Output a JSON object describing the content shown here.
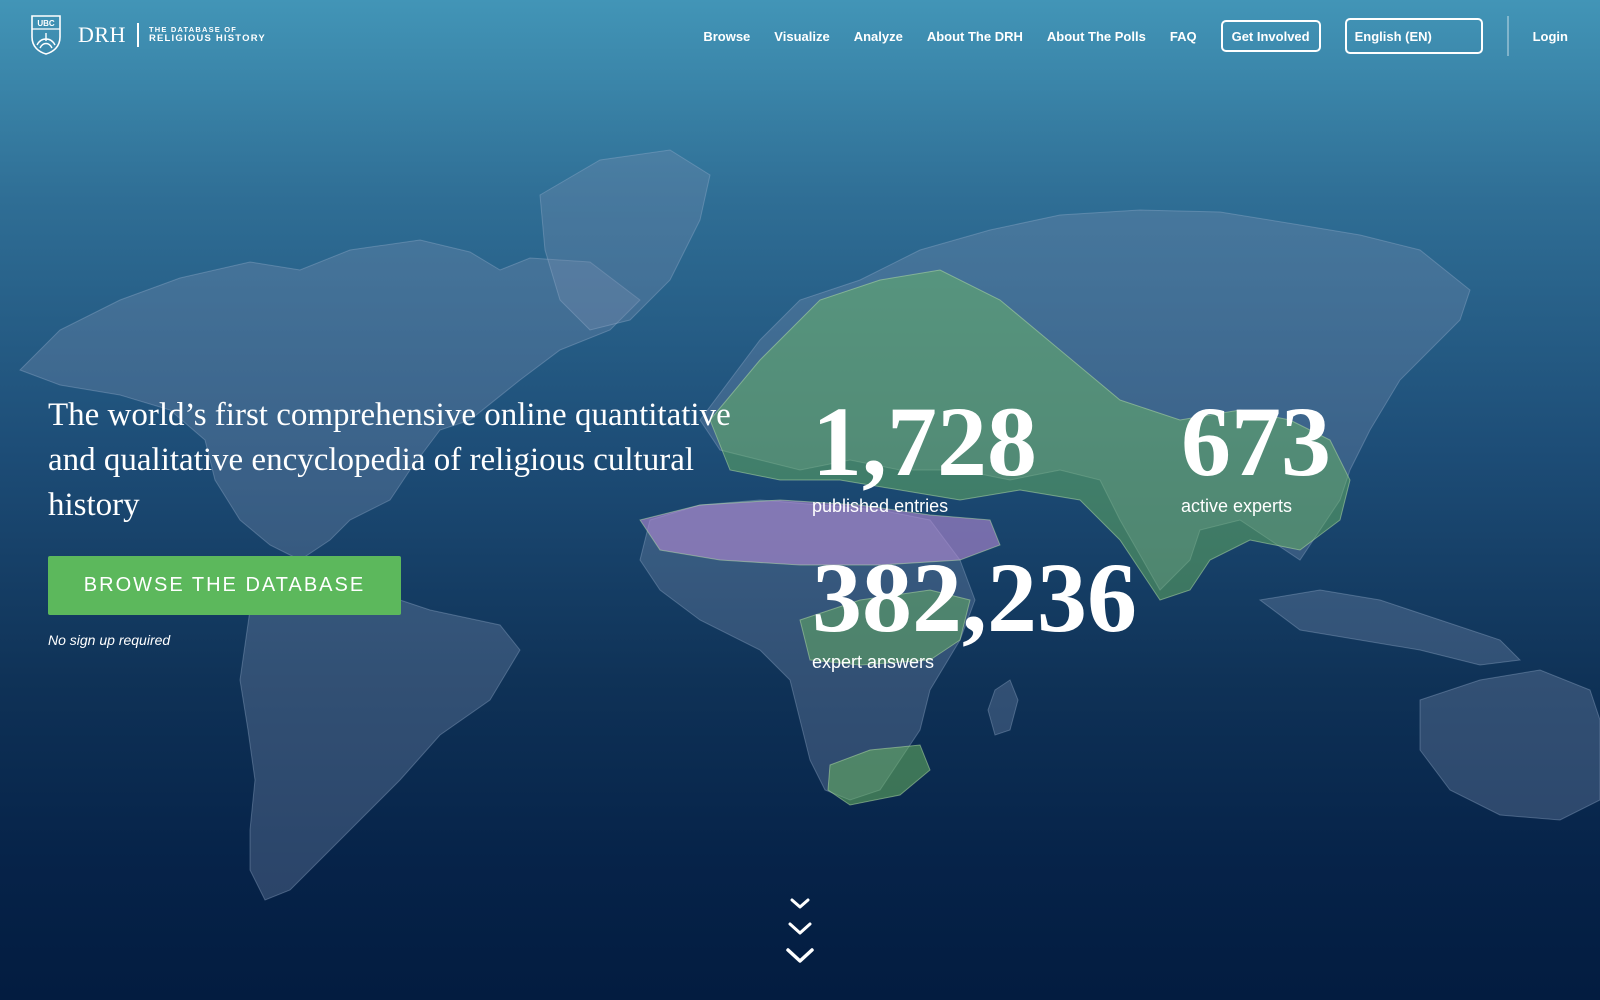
{
  "header": {
    "logo": {
      "crest_text": "UBC",
      "abbrev": "DRH",
      "subtitle_line1": "THE DATABASE OF",
      "subtitle_line2": "RELIGIOUS HISTORY"
    },
    "nav": [
      {
        "label": "Browse"
      },
      {
        "label": "Visualize"
      },
      {
        "label": "Analyze"
      },
      {
        "label": "About The DRH"
      },
      {
        "label": "About The Polls"
      },
      {
        "label": "FAQ"
      }
    ],
    "get_involved": "Get Involved",
    "language": "English (EN)",
    "login": "Login"
  },
  "hero": {
    "heading": "The world’s first comprehensive online quantitative and qualitative encyclopedia of religious cultural history",
    "cta": "BROWSE THE DATABASE",
    "cta_note": "No sign up required"
  },
  "stats": {
    "entries": {
      "value": "1,728",
      "label": "published entries"
    },
    "experts": {
      "value": "673",
      "label": "active experts"
    },
    "answers": {
      "value": "382,236",
      "label": "expert answers"
    }
  },
  "icons": {
    "crest": "ubc-crest-icon",
    "scroll": "chevron-down-icon"
  },
  "colors": {
    "accent_green": "#5cb85c",
    "background_top": "#4295b7",
    "background_bottom": "#031c40",
    "map_region_green": "#6fbf5f",
    "map_region_purple": "#b58bd6"
  }
}
